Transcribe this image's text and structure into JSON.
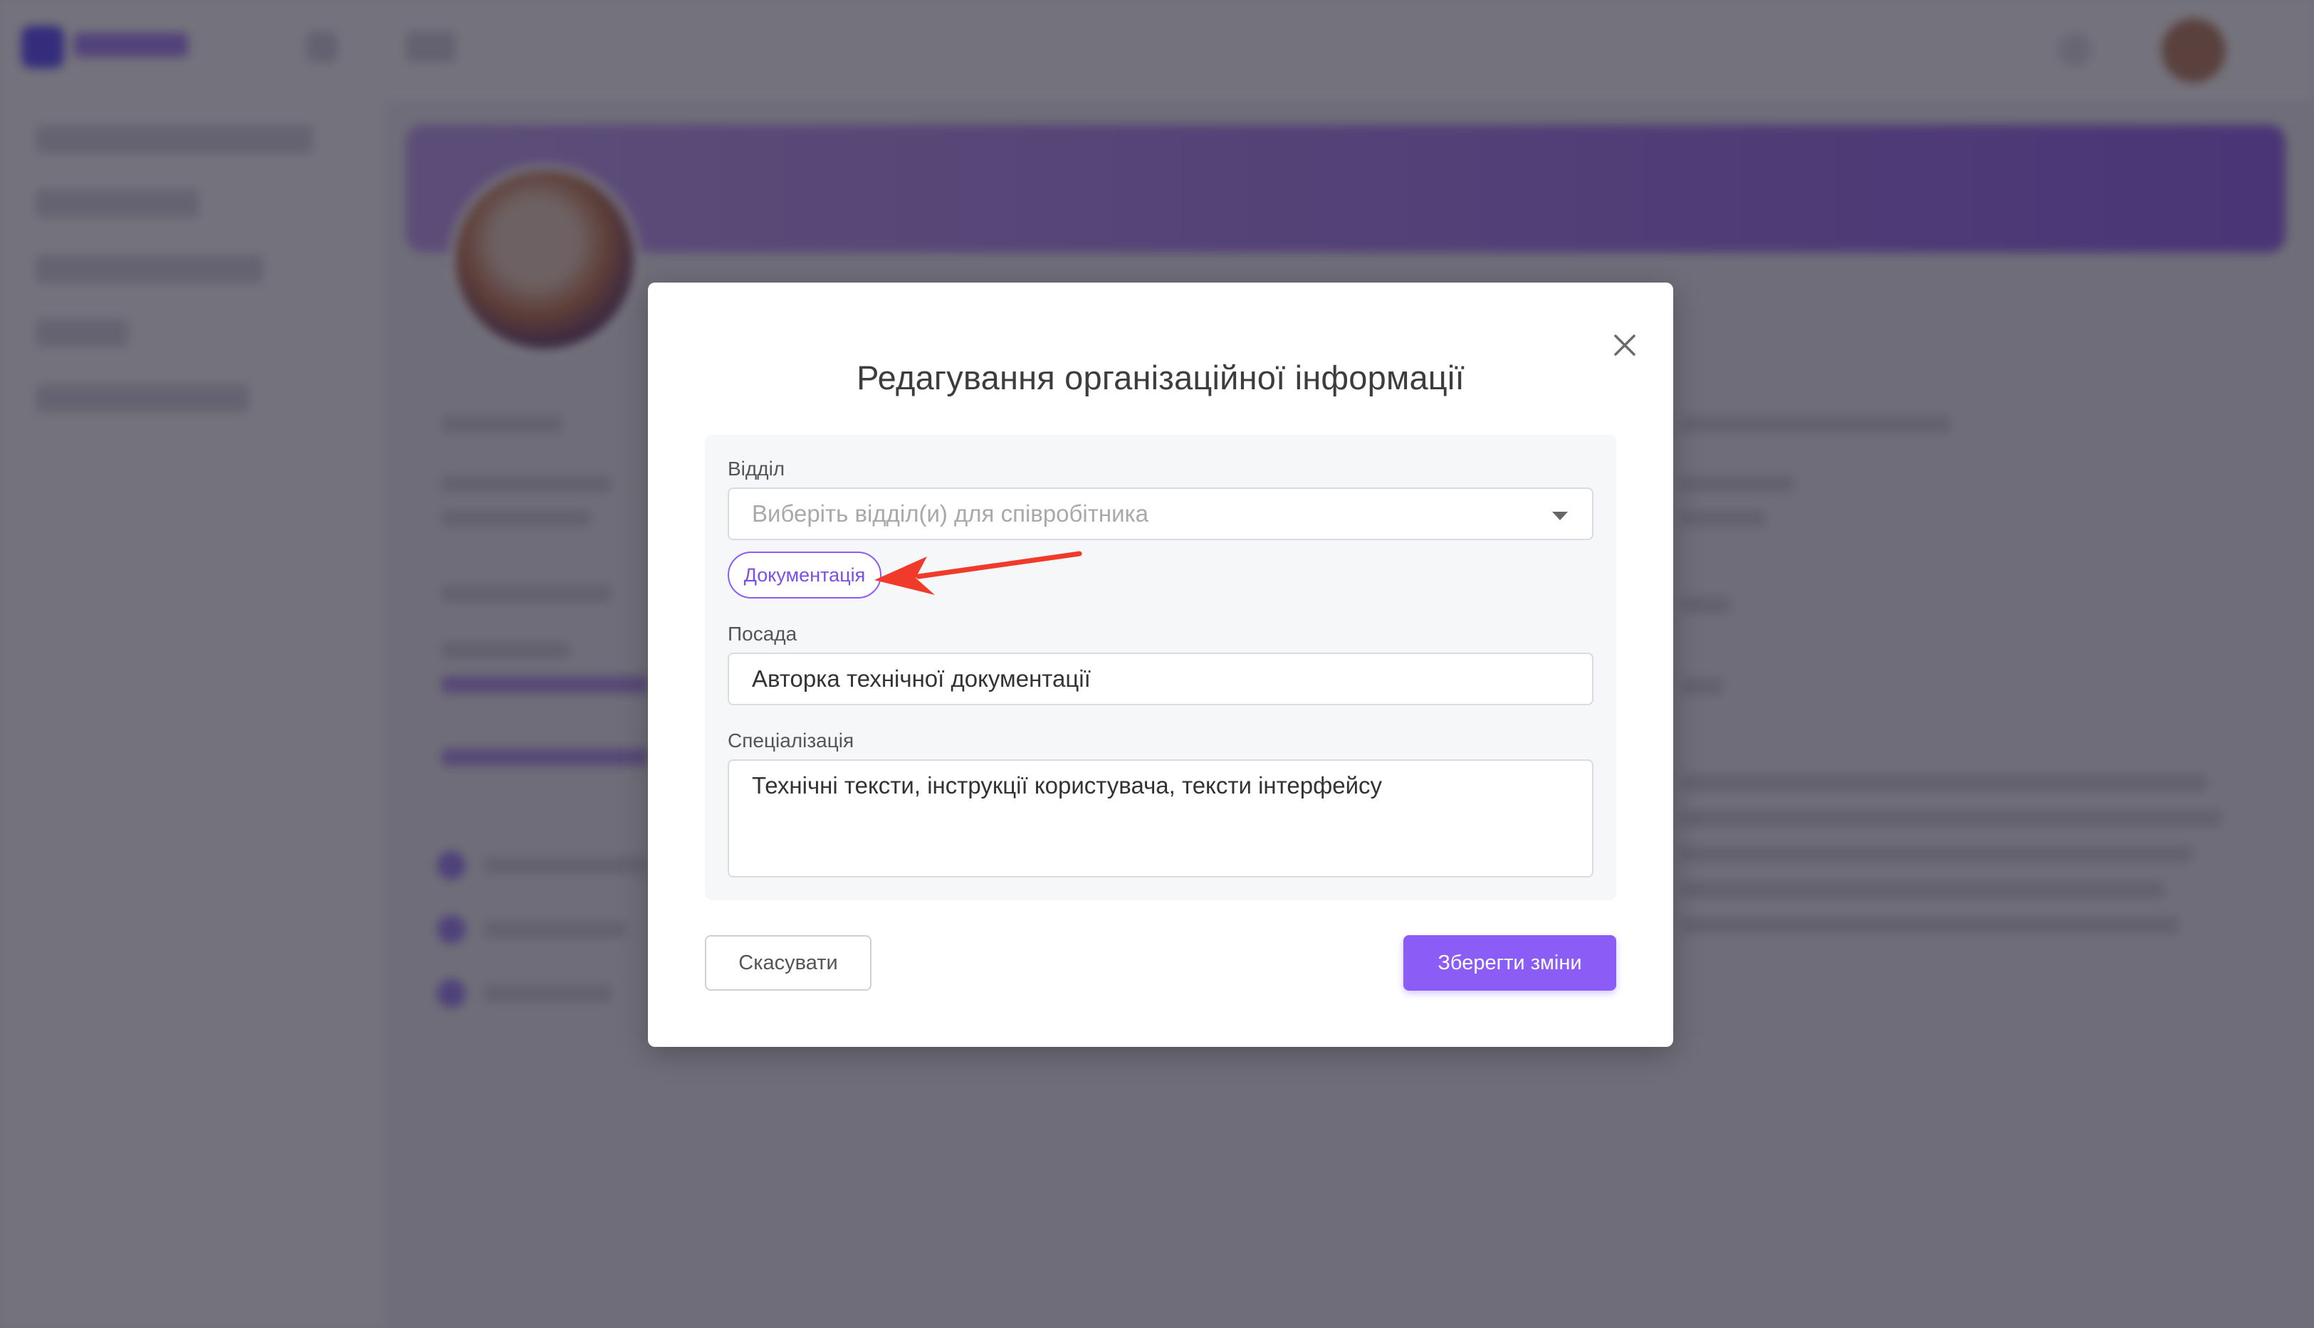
{
  "modal": {
    "title": "Редагування організаційної інформації",
    "department": {
      "label": "Відділ",
      "placeholder": "Виберіть відділ(и) для співробітника",
      "selected_tags": [
        "Документація"
      ]
    },
    "position": {
      "label": "Посада",
      "value": "Авторка технічної документації"
    },
    "specialization": {
      "label": "Спеціалізація",
      "value": "Технічні тексти, інструкції користувача, тексти інтерфейсу"
    },
    "cancel_label": "Скасувати",
    "save_label": "Зберегти зміни"
  },
  "colors": {
    "accent": "#8b5cf6",
    "annotation_arrow": "#f03a2a"
  },
  "icons": {
    "close": "close-icon",
    "dropdown": "chevron-down-icon"
  }
}
